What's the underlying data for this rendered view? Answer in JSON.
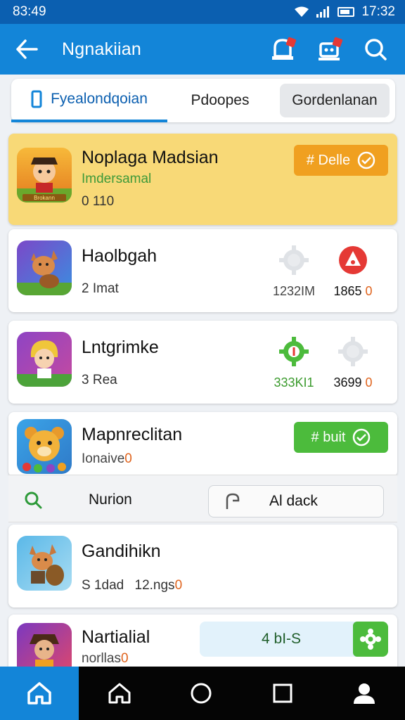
{
  "status": {
    "time_left": "83:49",
    "time_right": "17:32"
  },
  "appbar": {
    "title": "Ngnakiian"
  },
  "tabs": [
    {
      "label": "Fyealondqoian"
    },
    {
      "label": "Pdoopes"
    },
    {
      "label": "Gordenlanan"
    }
  ],
  "cards": {
    "c1": {
      "title": "Noplaga Madsian",
      "subtitle": "Imdersamal",
      "meta": "0 110",
      "button": "# Delle",
      "icon_caption": "Brokann"
    },
    "c2": {
      "title": "Haolbgah",
      "meta": "2 Imat",
      "stat1": "1232IM",
      "stat2_text": "1865",
      "stat2_accent": "0"
    },
    "c3": {
      "title": "Lntgrimke",
      "meta": "3 Rea",
      "stat1": "333KI1",
      "stat2_text": "3699",
      "stat2_accent": "0"
    },
    "c4": {
      "title": "Mapnreclitan",
      "sub_text": "Ionaive",
      "sub_accent": "0",
      "button": "# buit"
    },
    "c5": {
      "title": "Gandihikn",
      "meta_a": "S 1dad",
      "meta_b_text": "12.ngs",
      "meta_b_accent": "0"
    },
    "c6": {
      "title": "Nartialial",
      "sub_text": "norllas",
      "sub_accent": "0",
      "progress_label": "4 bI-S"
    }
  },
  "search_row": {
    "label": "Nurion",
    "pill": "Al dack"
  },
  "colors": {
    "appbar": "#1385d8",
    "status": "#0b5fb0",
    "orange": "#f0a020",
    "green": "#4cbb3c",
    "red": "#e53935"
  },
  "icons": [
    "back-arrow-icon",
    "bell-icon",
    "robot-icon",
    "search-icon",
    "phone-icon",
    "settings-icon",
    "alert-icon",
    "check-icon",
    "home-icon",
    "circle-icon",
    "square-icon",
    "person-icon"
  ]
}
